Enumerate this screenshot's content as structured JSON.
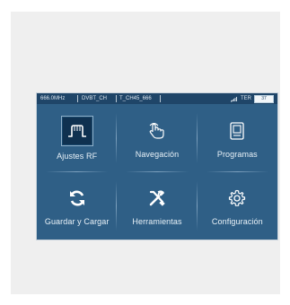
{
  "status": {
    "frequency": "666.0MHz",
    "standard": "DVBT_CH",
    "channel": "T_CH45_666",
    "band": "TER",
    "level": "37"
  },
  "menu": [
    {
      "label": "Ajustes RF",
      "icon": "rf-signal-icon",
      "selected": true
    },
    {
      "label": "Navegación",
      "icon": "hand-gesture-icon"
    },
    {
      "label": "Programas",
      "icon": "program-list-icon"
    },
    {
      "label": "Guardar y Cargar",
      "icon": "save-load-icon"
    },
    {
      "label": "Herramientas",
      "icon": "tools-icon"
    },
    {
      "label": "Configuración",
      "icon": "gear-icon"
    }
  ]
}
